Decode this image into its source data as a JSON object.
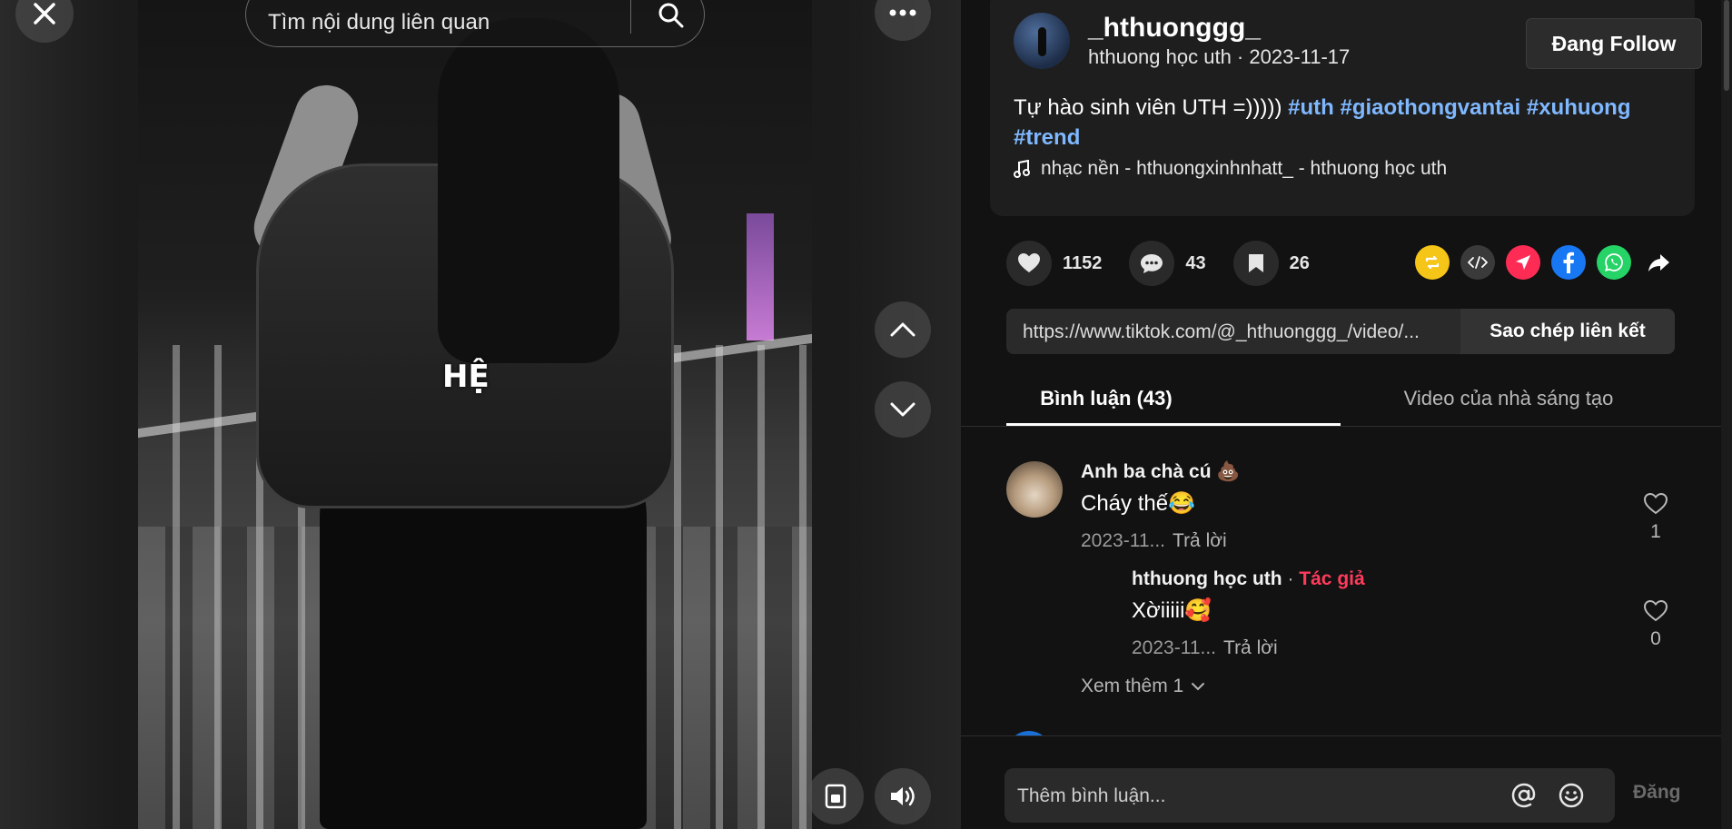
{
  "search": {
    "placeholder": "Tìm nội dung liên quan"
  },
  "video": {
    "overlay_text": "HỆ"
  },
  "post": {
    "username": "_hthuonggg_",
    "display_name": "hthuong học uth",
    "date": "2023-11-17",
    "follow_label": "Đang Follow",
    "caption": "Tự hào sinh viên UTH =)))))",
    "hashtags": [
      "#uth",
      "#giaothongvantai",
      "#xuhuong",
      "#trend"
    ],
    "music": "nhạc nền - hthuongxinhnhatt_ - hthuong học uth"
  },
  "stats": {
    "likes": "1152",
    "comments": "43",
    "saves": "26"
  },
  "share_icons": [
    {
      "name": "repost-icon",
      "color": "#f5c518"
    },
    {
      "name": "embed-icon",
      "color": "#3a3a3a"
    },
    {
      "name": "send-icon",
      "color": "#fe2c55"
    },
    {
      "name": "facebook-icon",
      "color": "#1877f2"
    },
    {
      "name": "whatsapp-icon",
      "color": "#25d366"
    }
  ],
  "link": {
    "url": "https://www.tiktok.com/@_hthuonggg_/video/...",
    "copy_label": "Sao chép liên kết"
  },
  "tabs": {
    "comments": "Bình luận (43)",
    "creator_videos": "Video của nhà sáng tạo"
  },
  "comments": [
    {
      "name": "Anh ba chà cú 💩",
      "text": "Cháy thế😂",
      "time": "2023-11...",
      "reply_label": "Trả lời",
      "likes": "1",
      "replies": [
        {
          "name": "hthuong học uth",
          "author_tag": "Tác giả",
          "separator": " · ",
          "text": "Xờiiiii🥰",
          "time": "2023-11...",
          "reply_label": "Trả lời",
          "likes": "0"
        }
      ],
      "see_more": "Xem thêm 1"
    }
  ],
  "compose": {
    "placeholder": "Thêm bình luận...",
    "post_label": "Đăng"
  },
  "colors": {
    "accent": "#fe2c55",
    "hashtag": "#7fb8ff",
    "background": "#121212"
  }
}
